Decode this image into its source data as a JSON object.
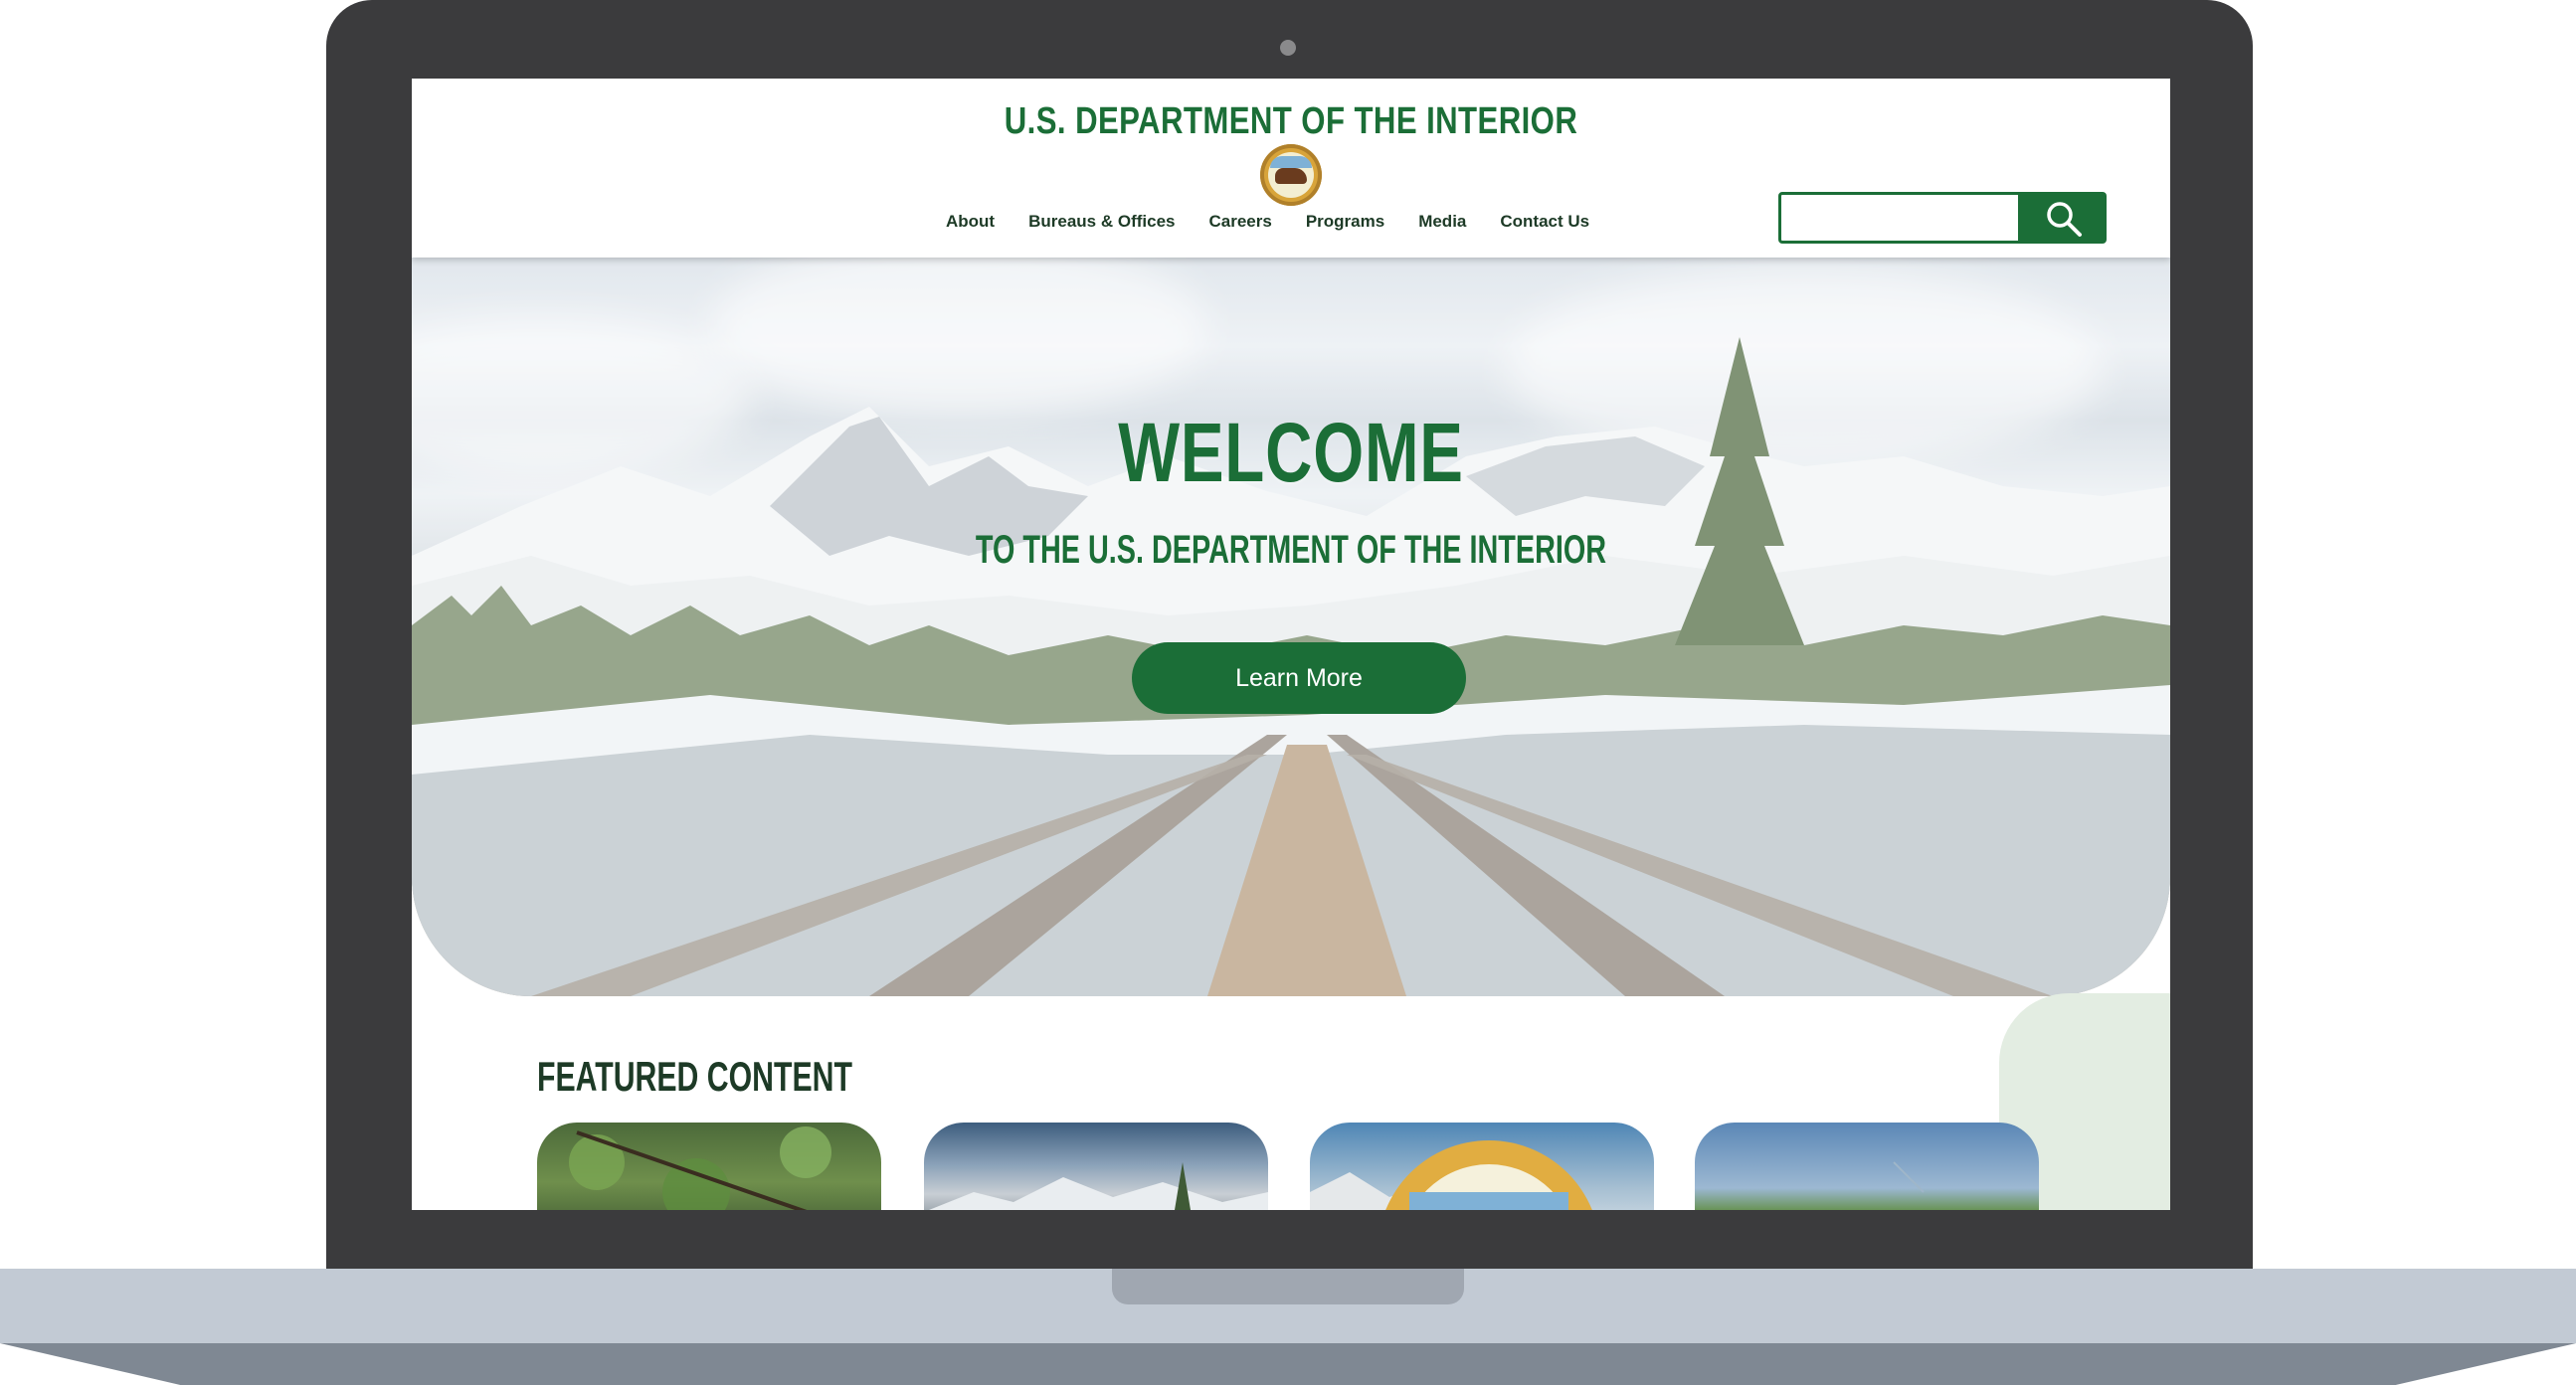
{
  "header": {
    "site_title": "U.S. DEPARTMENT OF THE INTERIOR",
    "seal_icon": "doi-seal-icon"
  },
  "nav": {
    "items": [
      "About",
      "Bureaus & Offices",
      "Careers",
      "Programs",
      "Media",
      "Contact Us"
    ]
  },
  "search": {
    "placeholder": "",
    "button_icon": "search-icon"
  },
  "hero": {
    "welcome": "WELCOME",
    "subtitle": "TO THE U.S. DEPARTMENT OF THE INTERIOR",
    "cta_label": "Learn More",
    "background": "mountain-bridge-photo"
  },
  "featured": {
    "title": "FEATURED CONTENT",
    "cards": [
      {
        "image": "grass-photo"
      },
      {
        "image": "mountain-photo"
      },
      {
        "image": "doi-seal-photo"
      },
      {
        "image": "prairie-photo"
      }
    ]
  },
  "colors": {
    "brand_green": "#1b6e37",
    "dark_text": "#1d3a26",
    "laptop_frame": "#3b3b3d",
    "laptop_base": "#c2cad4"
  }
}
